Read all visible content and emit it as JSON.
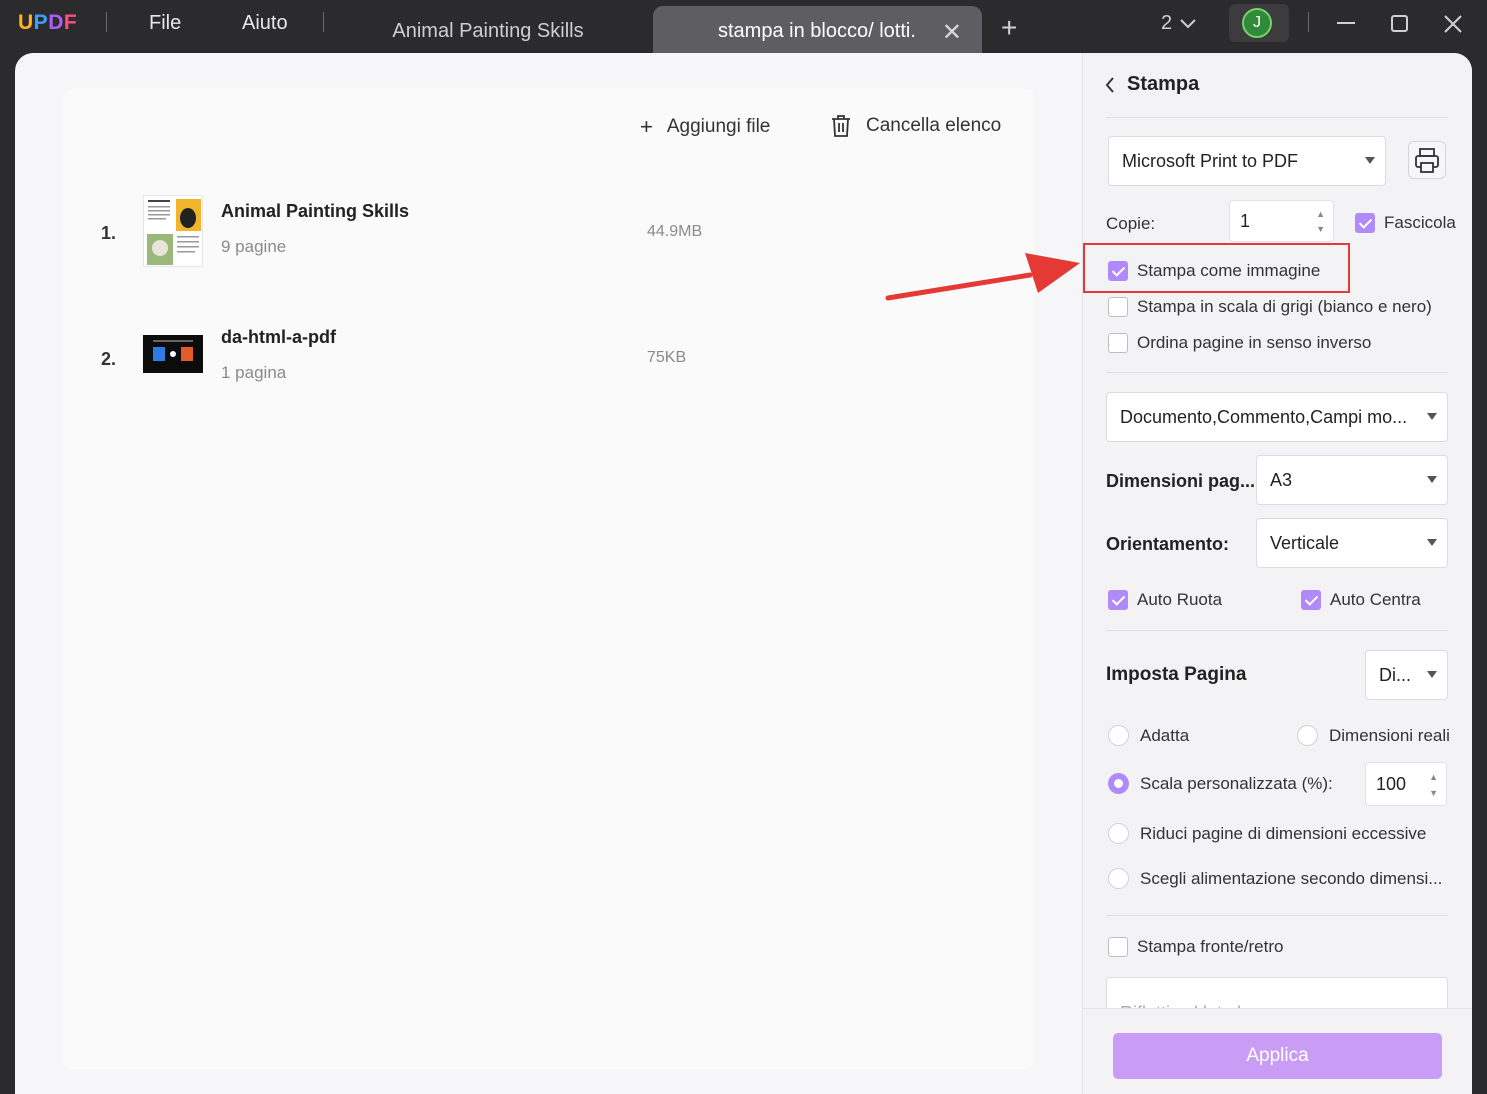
{
  "app": {
    "logo": "UPDF",
    "menus": [
      "File",
      "Aiuto"
    ],
    "tabs": [
      {
        "label": "Animal Painting Skills",
        "active": false
      },
      {
        "label": "stampa in blocco/ lotti.",
        "active": true
      }
    ],
    "window_count": "2",
    "avatar_initial": "J"
  },
  "toolbar": {
    "add_files": "Aggiungi file",
    "clear_list": "Cancella elenco"
  },
  "files": [
    {
      "index": "1.",
      "name": "Animal Painting Skills",
      "pages": "9 pagine",
      "size": "44.9MB"
    },
    {
      "index": "2.",
      "name": "da-html-a-pdf",
      "pages": "1 pagina",
      "size": "75KB"
    }
  ],
  "print_panel": {
    "title": "Stampa",
    "printer": "Microsoft Print to PDF",
    "copies_label": "Copie:",
    "copies_value": "1",
    "collate": {
      "label": "Fascicola",
      "checked": true
    },
    "print_as_image": {
      "label": "Stampa come immagine",
      "checked": true
    },
    "grayscale": {
      "label": "Stampa in scala di grigi (bianco e nero)",
      "checked": false
    },
    "reverse": {
      "label": "Ordina pagine in senso inverso",
      "checked": false
    },
    "content": "Documento,Commento,Campi mo...",
    "page_size_label": "Dimensioni pag...",
    "page_size": "A3",
    "orientation_label": "Orientamento:",
    "orientation": "Verticale",
    "auto_rotate": {
      "label": "Auto Ruota",
      "checked": true
    },
    "auto_center": {
      "label": "Auto Centra",
      "checked": true
    },
    "page_setup_label": "Imposta Pagina",
    "page_setup_value": "Di...",
    "fit": "Adatta",
    "actual_size": "Dimensioni reali",
    "custom_scale": "Scala personalizzata (%):",
    "custom_scale_value": "100",
    "shrink": "Riduci pagine di dimensioni eccessive",
    "paper_source": "Scegli alimentazione secondo dimensi...",
    "duplex": {
      "label": "Stampa fronte/retro",
      "checked": false
    },
    "flip": "Rifletti sul lato lungo",
    "apply": "Applica"
  },
  "colors": {
    "accent": "#b08af8",
    "apply_button": "#c99df5",
    "annotation_red": "#e53935",
    "titlebar": "#2b2b2d"
  }
}
